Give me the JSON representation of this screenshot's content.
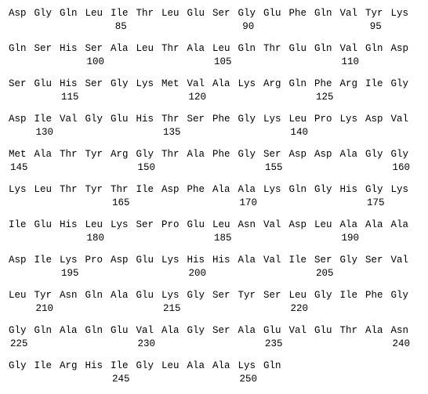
{
  "document": {
    "type": "protein-sequence-listing",
    "residue_naming": "three-letter-code",
    "residues_per_line": 16,
    "first_residue_number": 81,
    "last_residue_number": 251,
    "numbering_interval": 5,
    "text_color": "#000000",
    "background_color": "#ffffff"
  },
  "lines": [
    {
      "residues": [
        "Asp",
        "Gly",
        "Gln",
        "Leu",
        "Ile",
        "Thr",
        "Leu",
        "Glu",
        "Ser",
        "Gly",
        "Glu",
        "Phe",
        "Gln",
        "Val",
        "Tyr",
        "Lys"
      ],
      "numbers": [
        {
          "index": 4,
          "label": "85"
        },
        {
          "index": 9,
          "label": "90"
        },
        {
          "index": 14,
          "label": "95"
        }
      ]
    },
    {
      "residues": [
        "Gln",
        "Ser",
        "His",
        "Ser",
        "Ala",
        "Leu",
        "Thr",
        "Ala",
        "Leu",
        "Gln",
        "Thr",
        "Glu",
        "Gln",
        "Val",
        "Gln",
        "Asp"
      ],
      "numbers": [
        {
          "index": 3,
          "label": "100"
        },
        {
          "index": 8,
          "label": "105"
        },
        {
          "index": 13,
          "label": "110"
        }
      ]
    },
    {
      "residues": [
        "Ser",
        "Glu",
        "His",
        "Ser",
        "Gly",
        "Lys",
        "Met",
        "Val",
        "Ala",
        "Lys",
        "Arg",
        "Gln",
        "Phe",
        "Arg",
        "Ile",
        "Gly"
      ],
      "numbers": [
        {
          "index": 2,
          "label": "115"
        },
        {
          "index": 7,
          "label": "120"
        },
        {
          "index": 12,
          "label": "125"
        }
      ]
    },
    {
      "residues": [
        "Asp",
        "Ile",
        "Val",
        "Gly",
        "Glu",
        "His",
        "Thr",
        "Ser",
        "Phe",
        "Gly",
        "Lys",
        "Leu",
        "Pro",
        "Lys",
        "Asp",
        "Val"
      ],
      "numbers": [
        {
          "index": 1,
          "label": "130"
        },
        {
          "index": 6,
          "label": "135"
        },
        {
          "index": 11,
          "label": "140"
        }
      ]
    },
    {
      "residues": [
        "Met",
        "Ala",
        "Thr",
        "Tyr",
        "Arg",
        "Gly",
        "Thr",
        "Ala",
        "Phe",
        "Gly",
        "Ser",
        "Asp",
        "Asp",
        "Ala",
        "Gly",
        "Gly"
      ],
      "numbers": [
        {
          "index": 0,
          "label": "145"
        },
        {
          "index": 5,
          "label": "150"
        },
        {
          "index": 10,
          "label": "155"
        },
        {
          "index": 15,
          "label": "160"
        }
      ]
    },
    {
      "residues": [
        "Lys",
        "Leu",
        "Thr",
        "Tyr",
        "Thr",
        "Ile",
        "Asp",
        "Phe",
        "Ala",
        "Ala",
        "Lys",
        "Gln",
        "Gly",
        "His",
        "Gly",
        "Lys"
      ],
      "numbers": [
        {
          "index": 4,
          "label": "165"
        },
        {
          "index": 9,
          "label": "170"
        },
        {
          "index": 14,
          "label": "175"
        }
      ]
    },
    {
      "residues": [
        "Ile",
        "Glu",
        "His",
        "Leu",
        "Lys",
        "Ser",
        "Pro",
        "Glu",
        "Leu",
        "Asn",
        "Val",
        "Asp",
        "Leu",
        "Ala",
        "Ala",
        "Ala"
      ],
      "numbers": [
        {
          "index": 3,
          "label": "180"
        },
        {
          "index": 8,
          "label": "185"
        },
        {
          "index": 13,
          "label": "190"
        }
      ]
    },
    {
      "residues": [
        "Asp",
        "Ile",
        "Lys",
        "Pro",
        "Asp",
        "Glu",
        "Lys",
        "His",
        "His",
        "Ala",
        "Val",
        "Ile",
        "Ser",
        "Gly",
        "Ser",
        "Val"
      ],
      "numbers": [
        {
          "index": 2,
          "label": "195"
        },
        {
          "index": 7,
          "label": "200"
        },
        {
          "index": 12,
          "label": "205"
        }
      ]
    },
    {
      "residues": [
        "Leu",
        "Tyr",
        "Asn",
        "Gln",
        "Ala",
        "Glu",
        "Lys",
        "Gly",
        "Ser",
        "Tyr",
        "Ser",
        "Leu",
        "Gly",
        "Ile",
        "Phe",
        "Gly"
      ],
      "numbers": [
        {
          "index": 1,
          "label": "210"
        },
        {
          "index": 6,
          "label": "215"
        },
        {
          "index": 11,
          "label": "220"
        }
      ]
    },
    {
      "residues": [
        "Gly",
        "Gln",
        "Ala",
        "Gln",
        "Glu",
        "Val",
        "Ala",
        "Gly",
        "Ser",
        "Ala",
        "Glu",
        "Val",
        "Glu",
        "Thr",
        "Ala",
        "Asn"
      ],
      "numbers": [
        {
          "index": 0,
          "label": "225"
        },
        {
          "index": 5,
          "label": "230"
        },
        {
          "index": 10,
          "label": "235"
        },
        {
          "index": 15,
          "label": "240"
        }
      ]
    },
    {
      "residues": [
        "Gly",
        "Ile",
        "Arg",
        "His",
        "Ile",
        "Gly",
        "Leu",
        "Ala",
        "Ala",
        "Lys",
        "Gln"
      ],
      "numbers": [
        {
          "index": 4,
          "label": "245"
        },
        {
          "index": 9,
          "label": "250"
        }
      ]
    }
  ]
}
